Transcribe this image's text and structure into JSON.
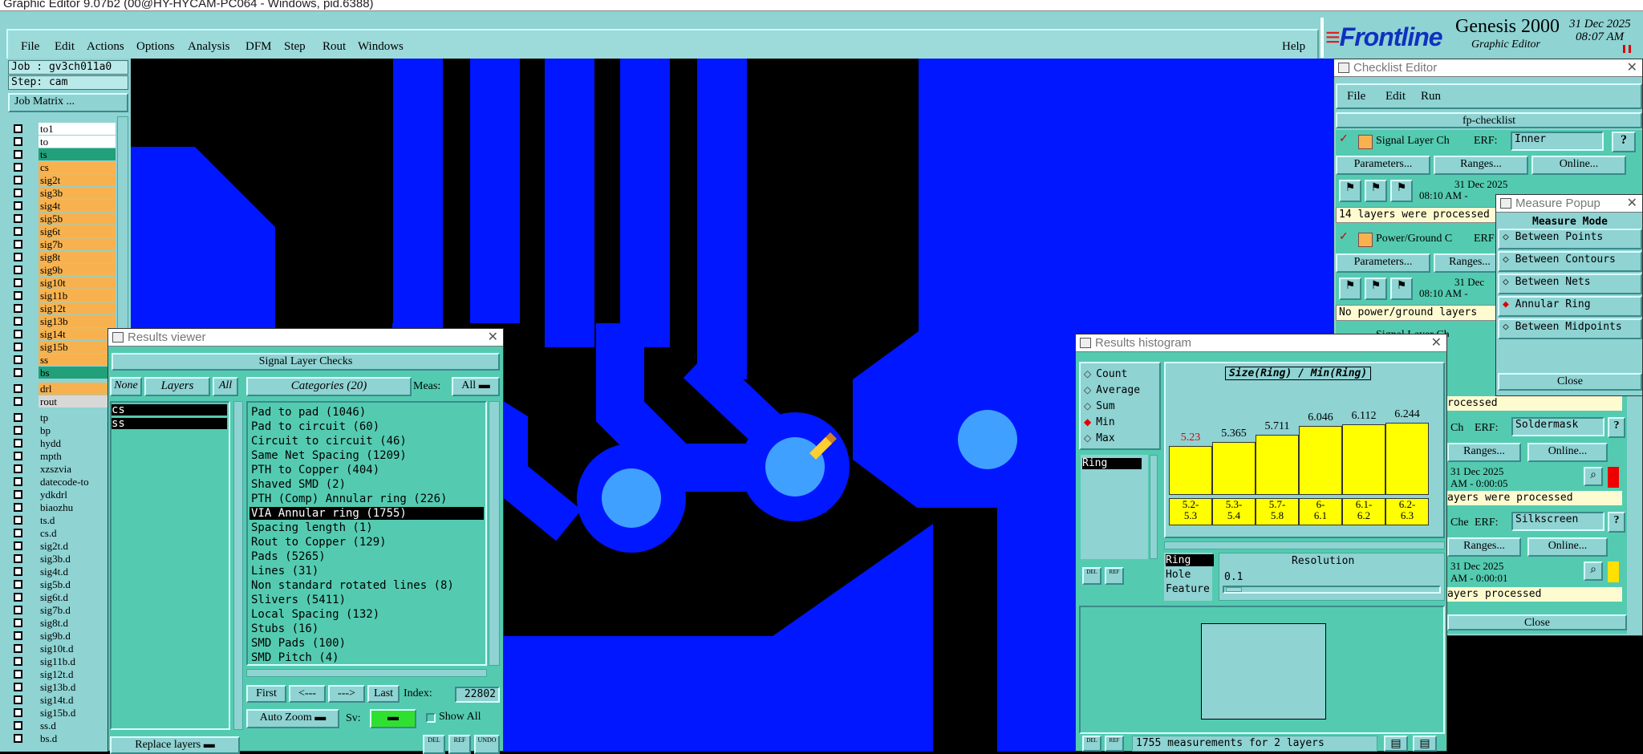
{
  "window_title": "Graphic Editor 9.07b2 (00@HY-HYCAM-PC064 - Windows, pid.6388)",
  "menu": [
    "File",
    "Edit",
    "Actions",
    "Options",
    "Analysis",
    "DFM",
    "Step",
    "Rout",
    "Windows"
  ],
  "help": "Help",
  "brand": {
    "name": "Frontline",
    "product": "Genesis 2000",
    "subtitle": "Graphic Editor",
    "date": "31 Dec 2025",
    "time": "08:07 AM"
  },
  "job": {
    "job": "Job : gv3ch011a0",
    "step": "Step: cam",
    "matrix": "Job Matrix ..."
  },
  "layers_top": [
    {
      "n": "to1",
      "c": "#ffffff"
    },
    {
      "n": "to",
      "c": "#ffffff"
    },
    {
      "n": "ts",
      "c": "#22a07a"
    },
    {
      "n": "cs",
      "c": "#f7b24f"
    },
    {
      "n": "sig2t",
      "c": "#f7b24f"
    },
    {
      "n": "sig3b",
      "c": "#f7b24f"
    },
    {
      "n": "sig4t",
      "c": "#f7b24f"
    },
    {
      "n": "sig5b",
      "c": "#f7b24f"
    },
    {
      "n": "sig6t",
      "c": "#f7b24f"
    },
    {
      "n": "sig7b",
      "c": "#f7b24f"
    },
    {
      "n": "sig8t",
      "c": "#f7b24f"
    },
    {
      "n": "sig9b",
      "c": "#f7b24f"
    },
    {
      "n": "sig10t",
      "c": "#f7b24f"
    },
    {
      "n": "sig11b",
      "c": "#f7b24f"
    },
    {
      "n": "sig12t",
      "c": "#f7b24f"
    },
    {
      "n": "sig13b",
      "c": "#f7b24f"
    },
    {
      "n": "sig14t",
      "c": "#f7b24f"
    },
    {
      "n": "sig15b",
      "c": "#f7b24f"
    },
    {
      "n": "ss",
      "c": "#f7b24f"
    },
    {
      "n": "bs",
      "c": "#22a07a"
    }
  ],
  "layers_mid": [
    {
      "n": "drl",
      "c": "#f7b24f"
    },
    {
      "n": "rout",
      "c": "#d8d8d8"
    }
  ],
  "layers_bottom": [
    "tp",
    "bp",
    "hydd",
    "mpth",
    "xzszvia",
    "datecode-to",
    "ydkdrl",
    "biaozhu",
    "ts.d",
    "cs.d",
    "sig2t.d",
    "sig3b.d",
    "sig4t.d",
    "sig5b.d",
    "sig6t.d",
    "sig7b.d",
    "sig8t.d",
    "sig9b.d",
    "sig10t.d",
    "sig11b.d",
    "sig12t.d",
    "sig13b.d",
    "sig14t.d",
    "sig15b.d",
    "ss.d",
    "bs.d"
  ],
  "results_viewer": {
    "title": "Results viewer",
    "heading": "Signal Layer Checks",
    "none": "None",
    "layers": "Layers",
    "all": "All",
    "categories": "Categories (20)",
    "meas": "Meas:",
    "meas_val": "All",
    "layer_items": [
      "cs",
      "ss"
    ],
    "category_items": [
      "Pad to pad (1046)",
      "Pad to circuit (60)",
      "Circuit to circuit (46)",
      "Same Net Spacing (1209)",
      "PTH to Copper (404)",
      "Shaved SMD (2)",
      "PTH (Comp) Annular ring (226)",
      "VIA Annular ring (1755)",
      "Spacing length (1)",
      "Rout to Copper (129)",
      "Pads (5265)",
      "Lines (31)",
      "Non standard rotated lines (8)",
      "Slivers (5411)",
      "Local Spacing (132)",
      "Stubs (16)",
      "SMD Pads (100)",
      "SMD Pitch (4)"
    ],
    "selected": "VIA Annular ring (1755)",
    "first": "First",
    "prev": "<---",
    "next": "--->",
    "last": "Last",
    "index_label": "Index:",
    "index_val": "22802",
    "autozoom": "Auto Zoom",
    "sv": "Sv:",
    "showall": "Show All",
    "replace": "Replace layers",
    "del": "DEL",
    "ref": "REF",
    "undo": "UNDO"
  },
  "histogram": {
    "title": "Results histogram",
    "mode_label": "Size(Ring) / Min(Ring)",
    "stats": [
      "Count",
      "Average",
      "Sum",
      "Min",
      "Max"
    ],
    "stat_selected": "Min",
    "list_item": "Ring",
    "values": [
      "5.23",
      "5.365",
      "5.711",
      "6.046",
      "6.112",
      "6.244"
    ],
    "value_colors": [
      "#e00000",
      "#000000",
      "#000000",
      "#000000",
      "#000000",
      "#000000"
    ],
    "bins": [
      "5.2-\n5.3",
      "5.3-\n5.4",
      "5.7-\n5.8",
      "6-\n6.1",
      "6.1-\n6.2",
      "6.2-\n6.3"
    ],
    "bar_levels": [
      0.55,
      0.6,
      0.68,
      0.78,
      0.8,
      0.82
    ],
    "fields": [
      "Ring",
      "Hole",
      "Feature"
    ],
    "resolution_label": "Resolution",
    "resolution": "0.1",
    "footer": "1755 measurements for 2 layers",
    "del": "DEL",
    "ref": "REF"
  },
  "checklist": {
    "title": "Checklist Editor",
    "menu": [
      "File",
      "Edit",
      "Run"
    ],
    "name": "fp-checklist",
    "item1": "Signal Layer Ch",
    "erf": "ERF:",
    "erf1": "Inner",
    "params": "Parameters...",
    "ranges": "Ranges...",
    "online": "Online...",
    "date1": "31 Dec 2025",
    "time1": "08:10 AM -",
    "status1": "14 layers were processed",
    "item2": "Power/Ground C",
    "date2": "31 Dec",
    "time2": "08:10 AM -",
    "status2": "No power/ground layers",
    "item3": "Signal Layer Ch",
    "processed": "rocessed",
    "ch": "Ch",
    "erf4": "Soldermask",
    "date4": "31 Dec 2025",
    "time4": "AM - 0:00:05",
    "status4": "ayers were processed",
    "che": "Che",
    "erf5": "Silkscreen",
    "date5": "31 Dec 2025",
    "time5": "AM - 0:00:01",
    "status5": "ayers processed",
    "close": "Close"
  },
  "measure": {
    "title": "Measure Popup",
    "mode": "Measure Mode",
    "options": [
      "Between Points",
      "Between Contours",
      "Between Nets",
      "Annular Ring",
      "Between Midpoints"
    ],
    "selected": "Annular Ring",
    "close": "Close"
  }
}
